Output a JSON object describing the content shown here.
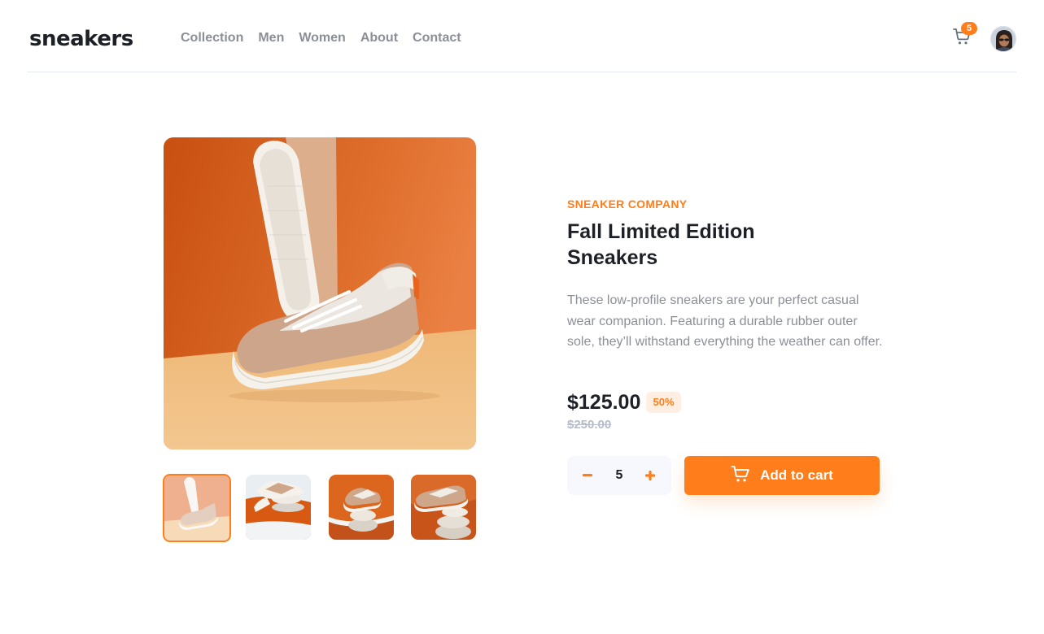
{
  "header": {
    "logo": "sneakers",
    "nav": [
      "Collection",
      "Men",
      "Women",
      "About",
      "Contact"
    ],
    "cart_count": "5",
    "cart_icon": "cart-icon",
    "avatar_icon": "avatar"
  },
  "gallery": {
    "main_image": "sneaker-main-image",
    "thumbnails": [
      "thumbnail-1",
      "thumbnail-2",
      "thumbnail-3",
      "thumbnail-4"
    ],
    "active_thumbnail": 0
  },
  "product": {
    "company": "SNEAKER COMPANY",
    "title_line1": "Fall Limited Edition",
    "title_line2": "Sneakers",
    "description": "These low-profile sneakers are your perfect casual wear companion. Featuring a durable rubber outer sole, they’ll withstand everything the weather can offer.",
    "price": "$125.00",
    "discount": "50%",
    "original_price": "$250.00"
  },
  "cart_controls": {
    "quantity": "5",
    "add_to_cart_label": "Add to cart",
    "minus_icon": "minus-icon",
    "plus_icon": "plus-icon"
  },
  "colors": {
    "accent": "#ff7e1b",
    "accent_pale": "#ffeee2",
    "dark": "#1d2026",
    "grey": "#8c8f96",
    "light_grey": "#f6f8fd"
  }
}
